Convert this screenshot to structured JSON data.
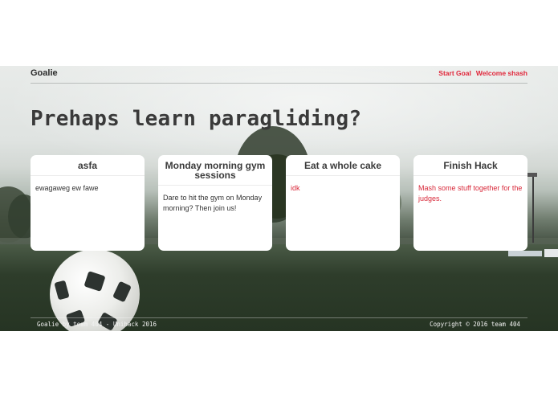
{
  "nav": {
    "brand": "Goalie",
    "links": [
      {
        "label": "Start Goal"
      },
      {
        "label": "Welcome shash"
      }
    ]
  },
  "headline": "Prehaps learn paragliding?",
  "cards": [
    {
      "title": "asfa",
      "body": "ewagaweg ew fawe"
    },
    {
      "title": "Monday morning gym sessions",
      "body": "Dare to hit the gym on Monday morning? Then join us!"
    },
    {
      "title": "Eat a whole cake",
      "body": "idk"
    },
    {
      "title": "Finish Hack",
      "body": "Mash some stuff together for the judges."
    }
  ],
  "footer": {
    "left": "Goalie by team 404 - Unihack 2016",
    "right": "Copyright © 2016 team 404"
  },
  "colors": {
    "accent": "#e0263a",
    "body_red": "#d8293a"
  },
  "icons": [
    "soccer-ball-image"
  ]
}
